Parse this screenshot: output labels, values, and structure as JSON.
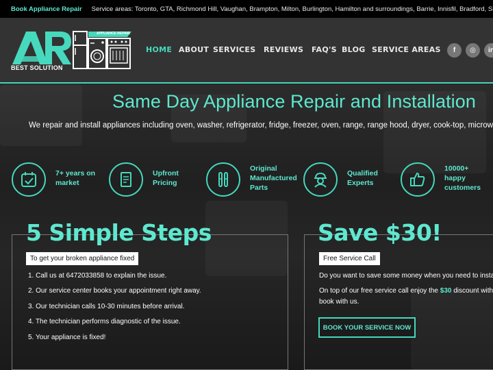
{
  "topbar": {
    "brand": "Book Appliance Repair",
    "areas": "Service areas: Toronto, GTA, Richmond Hill, Vaughan, Brampton, Milton, Burlington, Hamilton and surroundings, Barrie, Innisfil, Bradford, Simcoe County."
  },
  "logo": {
    "caption": "BEST SOLUTION",
    "tag": "APPLIANCE REPAIR"
  },
  "nav": [
    {
      "label": "HOME",
      "active": true
    },
    {
      "label": "ABOUT"
    },
    {
      "label": "SERVICES"
    },
    {
      "label": "REVIEWS"
    },
    {
      "label": "FAQ'S"
    },
    {
      "label": "BLOG"
    },
    {
      "label": "SERVICE AREAS"
    }
  ],
  "social": [
    {
      "label": "f",
      "icon": "facebook-icon"
    },
    {
      "label": "◎",
      "icon": "instagram-icon"
    },
    {
      "label": "in",
      "icon": "linkedin-icon"
    }
  ],
  "hero": {
    "title": "Same Day Appliance Repair and Installation",
    "subtitle": "We repair and install appliances including oven, washer, refrigerator, fridge, freezer, oven, range, range hood, dryer, cook-top, microwave oven"
  },
  "features": [
    {
      "line1": "7+ years on",
      "line2": "market",
      "line3": "",
      "icon": "calendar-check-icon"
    },
    {
      "line1": "Upfront",
      "line2": "Pricing",
      "line3": "",
      "icon": "price-list-icon"
    },
    {
      "line1": "Original",
      "line2": "Manufactured",
      "line3": "Parts",
      "icon": "tools-icon"
    },
    {
      "line1": "Qualified",
      "line2": "Experts",
      "line3": "",
      "icon": "technician-icon"
    },
    {
      "line1": "10000+",
      "line2": "happy",
      "line3": "customers",
      "icon": "thumbs-up-icon"
    }
  ],
  "steps": {
    "title": "5 Simple Steps",
    "tag": "To get your broken appliance fixed",
    "items": [
      "1. Call us at 6472033858 to explain the issue.",
      "2. Our service center books your appointment right away.",
      "3. Our technician calls 10-30 minutes before arrival.",
      "4. The technician performs diagnostic of the issue.",
      "5. Your appliance is fixed!"
    ]
  },
  "save": {
    "title": "Save $30!",
    "tag": "Free Service Call",
    "line1": "Do you want to save some money when you need to install or",
    "line2_pre": "On top of our free service call enjoy the ",
    "line2_hl": "$30",
    "line2_post": " discount with e",
    "line3": "book with us.",
    "button": "BOOK YOUR SERVICE NOW"
  },
  "colors": {
    "accent": "#46d9bd",
    "accent_text": "#5ee8cf",
    "header_bg": "#333333",
    "topbar_bg": "#000000"
  }
}
